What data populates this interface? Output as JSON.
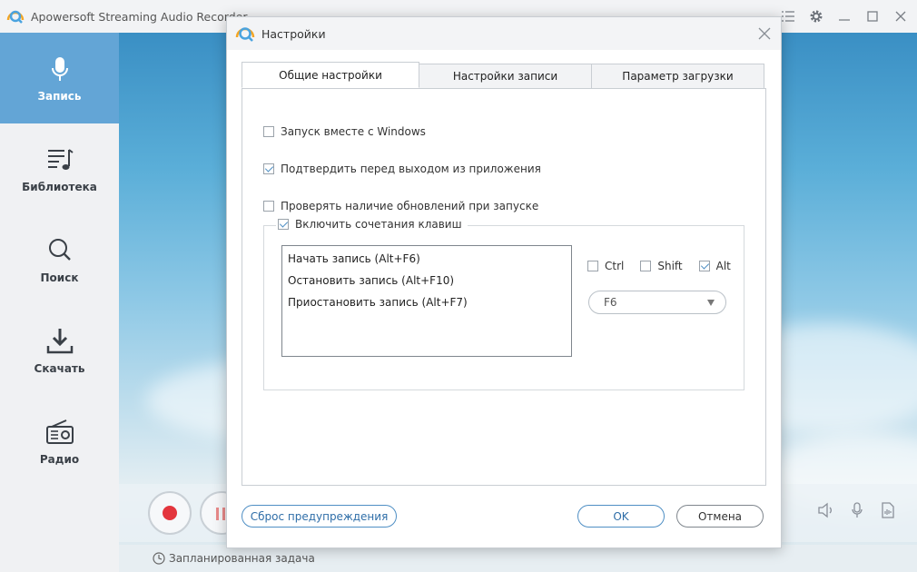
{
  "app": {
    "title": "Apowersoft Streaming Audio Recorder",
    "accent": "#63a5d6"
  },
  "sidebar": {
    "items": [
      {
        "label": "Запись",
        "icon": "microphone-icon",
        "active": true
      },
      {
        "label": "Библиотека",
        "icon": "music-list-icon",
        "active": false
      },
      {
        "label": "Поиск",
        "icon": "search-icon",
        "active": false
      },
      {
        "label": "Скачать",
        "icon": "download-icon",
        "active": false
      },
      {
        "label": "Радио",
        "icon": "radio-icon",
        "active": false
      }
    ]
  },
  "status": {
    "scheduled_task": "Запланированная задача"
  },
  "dialog": {
    "title": "Настройки",
    "tabs": [
      {
        "label": "Общие настройки",
        "active": true
      },
      {
        "label": "Настройки записи",
        "active": false
      },
      {
        "label": "Параметр загрузки",
        "active": false
      }
    ],
    "general": {
      "start_with_windows": {
        "label": "Запуск вместе с Windows",
        "checked": false
      },
      "confirm_exit": {
        "label": "Подтвердить перед выходом из приложения",
        "checked": true
      },
      "check_updates": {
        "label": "Проверять наличие обновлений при запуске",
        "checked": false
      },
      "hotkeys_enable": {
        "label": "Включить сочетания клавиш",
        "checked": true
      },
      "hotkeys": [
        "Начать запись (Alt+F6)",
        "Остановить запись (Alt+F10)",
        "Приостановить запись (Alt+F7)"
      ],
      "modifiers": [
        {
          "label": "Ctrl",
          "checked": false
        },
        {
          "label": "Shift",
          "checked": false
        },
        {
          "label": "Alt",
          "checked": true
        }
      ],
      "key_value": "F6"
    },
    "buttons": {
      "reset_warnings": "Сброс предупреждения",
      "ok": "OK",
      "cancel": "Отмена"
    }
  }
}
